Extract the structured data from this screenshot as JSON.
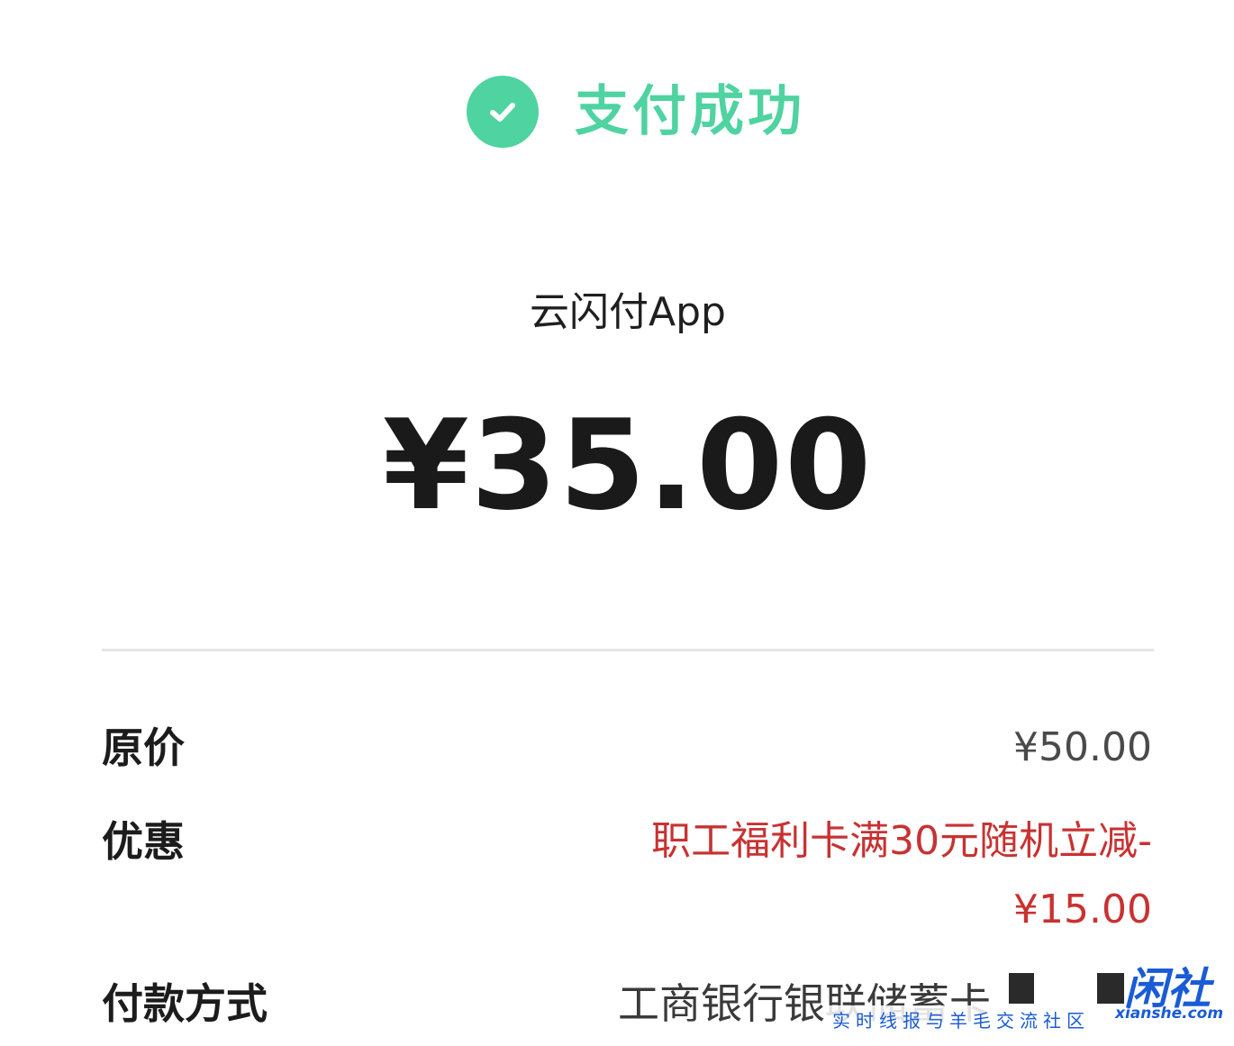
{
  "status": {
    "icon": "check-circle-icon",
    "title": "支付成功",
    "color": "#4fd3a0"
  },
  "merchant": {
    "name": "云闪付App"
  },
  "payment": {
    "amount": "¥35.00"
  },
  "details": {
    "original_price_label": "原价",
    "original_price_value": "¥50.00",
    "discount_label": "优惠",
    "discount_value_line1": "职工福利卡满30元随机立减-",
    "discount_value_line2": "¥15.00",
    "discount_color": "#c83232",
    "payment_method_label": "付款方式",
    "payment_method_value": "工商银行银联储蓄卡"
  },
  "watermark": {
    "logo_text": "闲社",
    "caption": "实时线报与羊毛交流社区",
    "domain": "xianshe.com"
  }
}
